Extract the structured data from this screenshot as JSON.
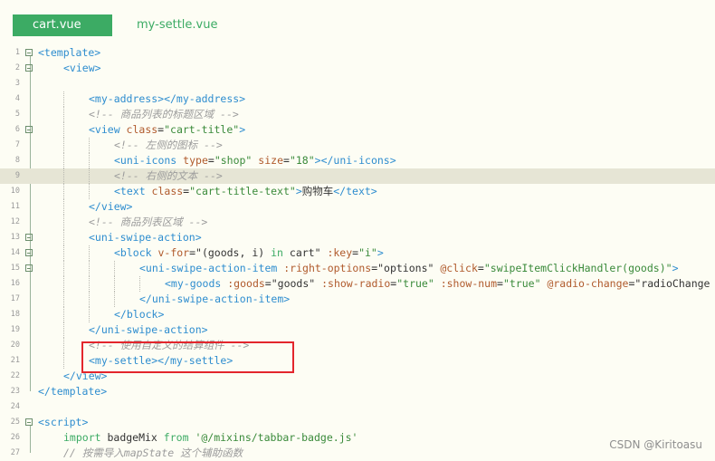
{
  "tabs": [
    {
      "label": "cart.vue",
      "active": true
    },
    {
      "label": "my-settle.vue",
      "active": false
    }
  ],
  "colors": {
    "accent": "#3cab64",
    "highlight_box": "#e3262d"
  },
  "watermark": "CSDN @Kiritoasu",
  "lines": [
    {
      "n": "1",
      "fold": true,
      "indent": 0,
      "tokens": [
        [
          "tag",
          "<template>"
        ]
      ]
    },
    {
      "n": "2",
      "fold": true,
      "indent": 1,
      "tokens": [
        [
          "tag",
          "<view>"
        ]
      ]
    },
    {
      "n": "3",
      "fold": false,
      "indent": 0,
      "tokens": []
    },
    {
      "n": "4",
      "fold": false,
      "indent": 2,
      "tokens": [
        [
          "tag",
          "<my-address></my-address>"
        ]
      ]
    },
    {
      "n": "5",
      "fold": false,
      "indent": 2,
      "tokens": [
        [
          "cm",
          "<!-- 商品列表的标题区域 -->"
        ]
      ]
    },
    {
      "n": "6",
      "fold": true,
      "indent": 2,
      "tokens": [
        [
          "tag",
          "<view "
        ],
        [
          "attr",
          "class"
        ],
        [
          "txt",
          "="
        ],
        [
          "str",
          "\"cart-title\""
        ],
        [
          "tag",
          ">"
        ]
      ]
    },
    {
      "n": "7",
      "fold": false,
      "indent": 3,
      "tokens": [
        [
          "cm",
          "<!-- 左侧的图标 -->"
        ]
      ]
    },
    {
      "n": "8",
      "fold": false,
      "indent": 3,
      "tokens": [
        [
          "tag",
          "<uni-icons "
        ],
        [
          "attr",
          "type"
        ],
        [
          "txt",
          "="
        ],
        [
          "str",
          "\"shop\""
        ],
        [
          "txt",
          " "
        ],
        [
          "attr",
          "size"
        ],
        [
          "txt",
          "="
        ],
        [
          "str",
          "\"18\""
        ],
        [
          "tag",
          "></uni-icons>"
        ]
      ]
    },
    {
      "n": "9",
      "fold": false,
      "indent": 3,
      "hl": true,
      "tokens": [
        [
          "cm",
          "<!-- 右侧的文本 -->"
        ]
      ]
    },
    {
      "n": "10",
      "fold": false,
      "indent": 3,
      "tokens": [
        [
          "tag",
          "<text "
        ],
        [
          "attr",
          "class"
        ],
        [
          "txt",
          "="
        ],
        [
          "str",
          "\"cart-title-text\""
        ],
        [
          "tag",
          ">"
        ],
        [
          "txt",
          "购物车"
        ],
        [
          "tag",
          "</text>"
        ]
      ]
    },
    {
      "n": "11",
      "fold": false,
      "indent": 2,
      "tokens": [
        [
          "tag",
          "</view>"
        ]
      ]
    },
    {
      "n": "12",
      "fold": false,
      "indent": 2,
      "tokens": [
        [
          "cm",
          "<!-- 商品列表区域 -->"
        ]
      ]
    },
    {
      "n": "13",
      "fold": true,
      "indent": 2,
      "tokens": [
        [
          "tag",
          "<uni-swipe-action>"
        ]
      ]
    },
    {
      "n": "14",
      "fold": true,
      "indent": 3,
      "tokens": [
        [
          "tag",
          "<block "
        ],
        [
          "attr",
          "v-for"
        ],
        [
          "txt",
          "=\"(goods, i) "
        ],
        [
          "kw",
          "in"
        ],
        [
          "txt",
          " cart\" "
        ],
        [
          "attr",
          ":key"
        ],
        [
          "txt",
          "="
        ],
        [
          "str",
          "\"i\""
        ],
        [
          "tag",
          ">"
        ]
      ]
    },
    {
      "n": "15",
      "fold": true,
      "indent": 4,
      "tokens": [
        [
          "tag",
          "<uni-swipe-action-item "
        ],
        [
          "attr",
          ":right-options"
        ],
        [
          "txt",
          "=\"options\" "
        ],
        [
          "attr",
          "@click"
        ],
        [
          "txt",
          "="
        ],
        [
          "str",
          "\"swipeItemClickHandler(goods)\""
        ],
        [
          "tag",
          ">"
        ]
      ]
    },
    {
      "n": "16",
      "fold": false,
      "indent": 5,
      "tokens": [
        [
          "tag",
          "<my-goods "
        ],
        [
          "attr",
          ":goods"
        ],
        [
          "txt",
          "=\"goods\" "
        ],
        [
          "attr",
          ":show-radio"
        ],
        [
          "txt",
          "="
        ],
        [
          "str",
          "\"true\""
        ],
        [
          "txt",
          " "
        ],
        [
          "attr",
          ":show-num"
        ],
        [
          "txt",
          "="
        ],
        [
          "str",
          "\"true\""
        ],
        [
          "txt",
          " "
        ],
        [
          "attr",
          "@radio-change"
        ],
        [
          "txt",
          "=\"radioChange"
        ]
      ]
    },
    {
      "n": "17",
      "fold": false,
      "indent": 4,
      "tokens": [
        [
          "tag",
          "</uni-swipe-action-item>"
        ]
      ]
    },
    {
      "n": "18",
      "fold": false,
      "indent": 3,
      "tokens": [
        [
          "tag",
          "</block>"
        ]
      ]
    },
    {
      "n": "19",
      "fold": false,
      "indent": 2,
      "tokens": [
        [
          "tag",
          "</uni-swipe-action>"
        ]
      ]
    },
    {
      "n": "20",
      "fold": false,
      "indent": 2,
      "tokens": [
        [
          "cm",
          "<!-- 使用自定义的结算组件 -->"
        ]
      ]
    },
    {
      "n": "21",
      "fold": false,
      "indent": 2,
      "tokens": [
        [
          "tag",
          "<my-settle></my-settle>"
        ]
      ]
    },
    {
      "n": "22",
      "fold": false,
      "indent": 1,
      "tokens": [
        [
          "tag",
          "</view>"
        ]
      ]
    },
    {
      "n": "23",
      "fold": false,
      "indent": 0,
      "tokens": [
        [
          "tag",
          "</template>"
        ]
      ]
    },
    {
      "n": "24",
      "fold": false,
      "indent": 0,
      "tokens": []
    },
    {
      "n": "25",
      "fold": true,
      "indent": 0,
      "tokens": [
        [
          "tag",
          "<script>"
        ]
      ]
    },
    {
      "n": "26",
      "fold": false,
      "indent": 1,
      "tokens": [
        [
          "kw",
          "import"
        ],
        [
          "txt",
          " badgeMix "
        ],
        [
          "kw",
          "from"
        ],
        [
          "txt",
          " "
        ],
        [
          "str",
          "'@/mixins/tabbar-badge.js'"
        ]
      ]
    },
    {
      "n": "27",
      "fold": false,
      "indent": 1,
      "tokens": [
        [
          "cm",
          "// 按需导入mapState 这个辅助函数"
        ]
      ]
    }
  ]
}
